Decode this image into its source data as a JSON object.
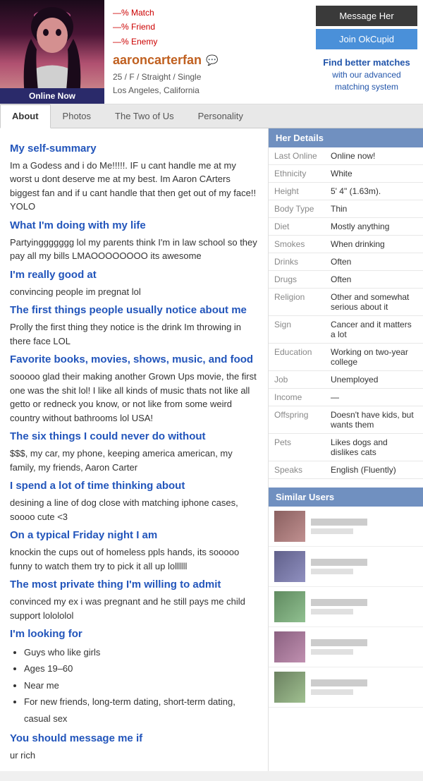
{
  "header": {
    "online_label": "Online Now",
    "match_percent": "—% Match",
    "friend_percent": "—% Friend",
    "enemy_percent": "—% Enemy",
    "username": "aaroncarterfan",
    "age_gender_orient": "25 / F / Straight / Single",
    "location": "Los Angeles, California",
    "btn_message": "Message Her",
    "btn_join": "Join OkCupid",
    "find_better_title": "Find better matches",
    "find_better_sub": "with our advanced matching system"
  },
  "nav": {
    "tabs": [
      "About",
      "Photos",
      "The Two of Us",
      "Personality"
    ],
    "active": "About"
  },
  "profile": {
    "sections": [
      {
        "id": "self-summary",
        "title": "My self-summary",
        "text": "Im a Godess and i do Me!!!!!. IF u cant handle me at my worst u dont deserve me at my best. Im Aaron CArters biggest fan and if u cant handle that then get out of my face!! YOLO"
      },
      {
        "id": "doing-with-life",
        "title": "What I'm doing with my life",
        "text": "Partyinggggggg lol my parents think I'm in law school so they pay all my bills LMAOOOOOOOO its awesome"
      },
      {
        "id": "really-good-at",
        "title": "I'm really good at",
        "text": "convincing people im pregnat lol"
      },
      {
        "id": "first-notice",
        "title": "The first things people usually notice about me",
        "text": "Prolly the first thing they notice is the drink Im throwing in there face LOL"
      },
      {
        "id": "favorite",
        "title": "Favorite books, movies, shows, music, and food",
        "text": "sooooo glad their making another Grown Ups movie, the first one was the shit lol! I like all kinds of music thats not like all getto or redneck you know, or not like from some weird country without bathrooms lol USA!"
      },
      {
        "id": "six-things",
        "title": "The six things I could never do without",
        "text": "$$$, my car, my phone, keeping america american, my family, my friends, Aaron Carter"
      },
      {
        "id": "thinking-about",
        "title": "I spend a lot of time thinking about",
        "text": "desining a line of dog close with matching iphone cases, soooo cute <3"
      },
      {
        "id": "friday-night",
        "title": "On a typical Friday night I am",
        "text": "knockin the cups out of homeless ppls hands, its sooooo funny to watch them try to pick it all up lollllll"
      },
      {
        "id": "private-thing",
        "title": "The most private thing I'm willing to admit",
        "text": "convinced my ex i was pregnant and he still pays me child support lolololol"
      }
    ],
    "looking_for": {
      "title": "I'm looking for",
      "items": [
        "Guys who like girls",
        "Ages 19–60",
        "Near me",
        "For new friends, long-term dating, short-term dating, casual sex"
      ]
    },
    "message_if": {
      "title": "You should message me if",
      "text": "ur rich"
    }
  },
  "her_details": {
    "header": "Her Details",
    "rows": [
      {
        "label": "Last Online",
        "value": "Online now!"
      },
      {
        "label": "Ethnicity",
        "value": "White"
      },
      {
        "label": "Height",
        "value": "5' 4\" (1.63m)."
      },
      {
        "label": "Body Type",
        "value": "Thin"
      },
      {
        "label": "Diet",
        "value": "Mostly anything"
      },
      {
        "label": "Smokes",
        "value": "When drinking"
      },
      {
        "label": "Drinks",
        "value": "Often"
      },
      {
        "label": "Drugs",
        "value": "Often"
      },
      {
        "label": "Religion",
        "value": "Other and somewhat serious about it"
      },
      {
        "label": "Sign",
        "value": "Cancer and it matters a lot"
      },
      {
        "label": "Education",
        "value": "Working on two-year college"
      },
      {
        "label": "Job",
        "value": "Unemployed"
      },
      {
        "label": "Income",
        "value": "—"
      },
      {
        "label": "Offspring",
        "value": "Doesn't have kids, but wants them"
      },
      {
        "label": "Pets",
        "value": "Likes dogs and dislikes cats",
        "pets": true
      },
      {
        "label": "Speaks",
        "value": "English (Fluently)"
      }
    ]
  },
  "similar_users": {
    "header": "Similar Users",
    "items": [
      {
        "thumb_class": "t1"
      },
      {
        "thumb_class": "t2"
      },
      {
        "thumb_class": "t3"
      },
      {
        "thumb_class": "t4"
      },
      {
        "thumb_class": "t5"
      }
    ]
  }
}
